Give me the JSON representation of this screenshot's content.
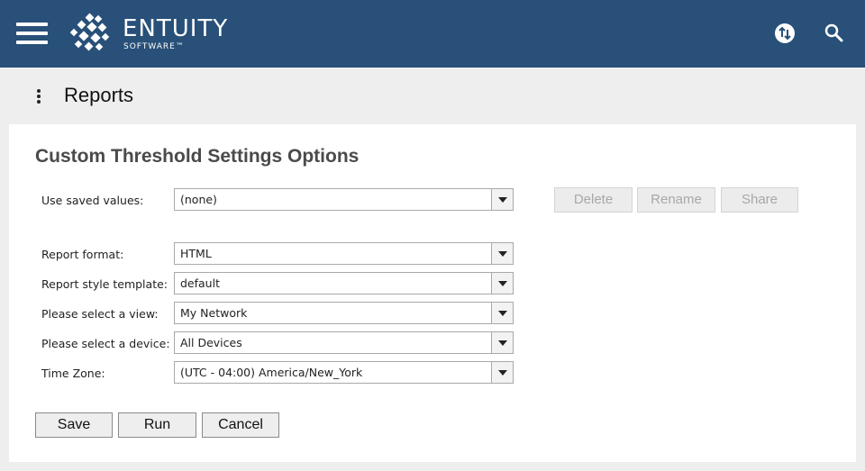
{
  "header": {
    "brand": "ENTUITY",
    "brand_sub": "SOFTWARE™"
  },
  "page": {
    "title": "Reports"
  },
  "form": {
    "title": "Custom Threshold Settings Options",
    "saved_values": {
      "label": "Use saved values:",
      "value": "(none)"
    },
    "saved_actions": {
      "delete": "Delete",
      "rename": "Rename",
      "share": "Share"
    },
    "fields": [
      {
        "label": "Report format:",
        "value": "HTML"
      },
      {
        "label": "Report style template:",
        "value": "default"
      },
      {
        "label": "Please select a view:",
        "value": "My Network"
      },
      {
        "label": "Please select a device:",
        "value": "All Devices"
      },
      {
        "label": "Time Zone:",
        "value": "(UTC - 04:00) America/New_York"
      }
    ],
    "actions": {
      "save": "Save",
      "run": "Run",
      "cancel": "Cancel"
    }
  },
  "colors": {
    "topbar": "#285079",
    "background": "#eeeeee"
  }
}
